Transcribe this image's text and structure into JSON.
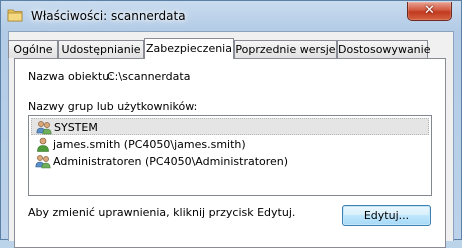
{
  "window": {
    "title": "Właściwości: scannerdata",
    "close_symbol": "✕"
  },
  "tabs": [
    {
      "label": "Ogólne",
      "active": false
    },
    {
      "label": "Udostępnianie",
      "active": false
    },
    {
      "label": "Zabezpieczenia",
      "active": true
    },
    {
      "label": "Poprzednie wersje",
      "active": false
    },
    {
      "label": "Dostosowywanie",
      "active": false
    }
  ],
  "security": {
    "object_name_label": "Nazwa obiektu:",
    "object_name_value": "C:\\scannerdata",
    "groups_label": "Nazwy grup lub użytkowników:",
    "principals": [
      {
        "name": "SYSTEM",
        "icon": "users-group-icon",
        "selected": true
      },
      {
        "name": "james.smith (PC4050\\james.smith)",
        "icon": "user-icon",
        "selected": false
      },
      {
        "name": "Administratoren (PC4050\\Administratoren)",
        "icon": "users-group-icon",
        "selected": false
      }
    ],
    "change_permissions_text": "Aby zmienić uprawnienia, kliknij przycisk Edytuj.",
    "edit_button_label": "Edytuj..."
  },
  "colors": {
    "close_button": "#c9452a",
    "selection": "#e5e5e5",
    "edit_button_border": "#3c7fb1"
  }
}
